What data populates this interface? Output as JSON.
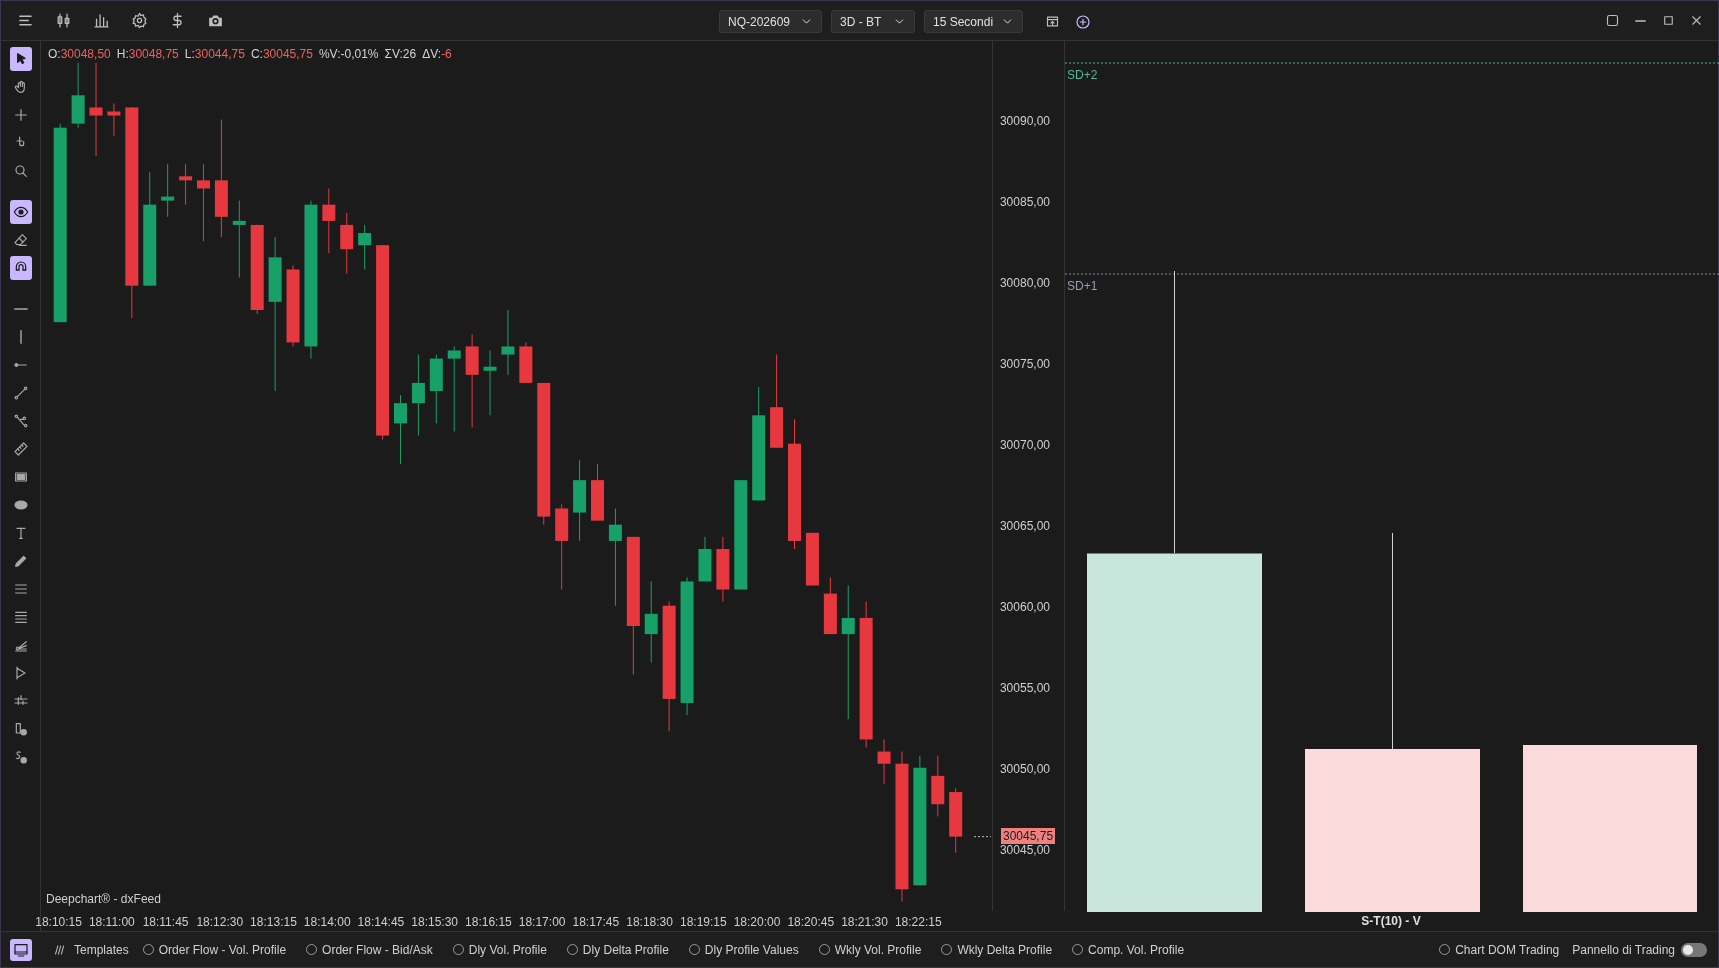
{
  "toolbar": {
    "instrument": "NQ-202609",
    "chart_type": "3D - BT",
    "interval": "15 Secondi"
  },
  "left_tools": [
    [
      {
        "selected": true
      },
      {
        "selected": false
      },
      {
        "selected": false
      },
      {
        "selected": false
      },
      {
        "selected": false
      }
    ],
    [
      {
        "selected": true
      },
      {
        "selected": false
      },
      {
        "selected": true
      }
    ],
    [
      {
        "selected": false
      },
      {
        "selected": false
      },
      {
        "selected": false
      },
      {
        "selected": false
      },
      {
        "selected": false
      },
      {
        "selected": false
      },
      {
        "selected": false
      },
      {
        "selected": false
      },
      {
        "selected": false
      },
      {
        "selected": false
      },
      {
        "selected": false
      },
      {
        "selected": false
      },
      {
        "selected": false
      },
      {
        "selected": false
      },
      {
        "selected": false
      },
      {
        "selected": false
      },
      {
        "selected": false
      }
    ]
  ],
  "ohlc": [
    {
      "label": "O:",
      "value": "30048,50",
      "color": "#f0605f"
    },
    {
      "label": "H:",
      "value": "30048,75",
      "color": "#f0605f"
    },
    {
      "label": "L:",
      "value": "30044,75",
      "color": "#f0605f"
    },
    {
      "label": "C:",
      "value": "30045,75",
      "color": "#f0605f"
    },
    {
      "label": "%V:",
      "value": "-0,01%",
      "color": "#d4d4d4"
    },
    {
      "label": "ΣV:",
      "value": "26",
      "color": "#d4d4d4"
    },
    {
      "label": "ΔV:",
      "value": "-6",
      "color": "#f0605f"
    }
  ],
  "chart_data": {
    "type": "candlestick",
    "ylim": [
      30041.1,
      30094.85
    ],
    "categories": [
      "18:10:15",
      null,
      null,
      "18:11:00",
      null,
      null,
      "18:11:45",
      null,
      null,
      "18:12:30",
      null,
      null,
      "18:13:15",
      null,
      null,
      "18:14:00",
      null,
      null,
      "18:14:45",
      null,
      null,
      "18:15:30",
      null,
      null,
      "18:16:15",
      null,
      null,
      "18:17:00",
      null,
      null,
      "18:17:45",
      null,
      null,
      "18:18:30",
      null,
      null,
      "18:19:15",
      null,
      null,
      "18:20:00",
      null,
      null,
      "18:20:45",
      null,
      null,
      "18:21:30",
      null,
      null,
      "18:22:15",
      null,
      null
    ],
    "ohlc": [
      [
        30077.5,
        30089.75,
        30077.5,
        30089.5
      ],
      [
        30089.75,
        30093.5,
        30089.5,
        30091.5
      ],
      [
        30090.75,
        30093.5,
        30087.75,
        30090.25
      ],
      [
        30090.5,
        30091,
        30089,
        30090.25
      ],
      [
        30090.75,
        30090.75,
        30077.75,
        30079.75
      ],
      [
        30079.75,
        30086.75,
        30079.75,
        30084.75
      ],
      [
        30085,
        30087.25,
        30084,
        30085.25
      ],
      [
        30086.5,
        30087.25,
        30084.75,
        30086.25
      ],
      [
        30086.25,
        30087.25,
        30082.5,
        30085.75
      ],
      [
        30086.25,
        30090,
        30082.75,
        30084
      ],
      [
        30083.5,
        30085,
        30080.25,
        30083.75
      ],
      [
        30083.5,
        30083.5,
        30078,
        30078.25
      ],
      [
        30078.75,
        30082.75,
        30073.25,
        30081.5
      ],
      [
        30080.75,
        30081,
        30076,
        30076.25
      ],
      [
        30076,
        30085,
        30075.25,
        30084.75
      ],
      [
        30084.75,
        30085.75,
        30081.75,
        30083.75
      ],
      [
        30083.5,
        30084.25,
        30080.5,
        30082
      ],
      [
        30082.25,
        30083.5,
        30080.75,
        30083
      ],
      [
        30082.25,
        30082.25,
        30070.25,
        30070.5
      ],
      [
        30071.25,
        30073,
        30068.75,
        30072.5
      ],
      [
        30072.5,
        30075.5,
        30070.5,
        30073.75
      ],
      [
        30073.25,
        30075.5,
        30071.25,
        30075.25
      ],
      [
        30075.25,
        30076,
        30070.75,
        30075.75
      ],
      [
        30076,
        30076.75,
        30071,
        30074.25
      ],
      [
        30074.5,
        30075.75,
        30071.75,
        30074.75
      ],
      [
        30075.5,
        30078.25,
        30074.25,
        30076
      ],
      [
        30076,
        30076.25,
        30073.75,
        30073.75
      ],
      [
        30073.75,
        30073.75,
        30065,
        30065.5
      ],
      [
        30066,
        30066.25,
        30061,
        30064
      ],
      [
        30065.75,
        30069,
        30064,
        30067.75
      ],
      [
        30067.75,
        30068.75,
        30065.25,
        30065.25
      ],
      [
        30064,
        30066,
        30060,
        30065
      ],
      [
        30064.25,
        30064.25,
        30055.75,
        30058.75
      ],
      [
        30058.25,
        30061.5,
        30056.5,
        30059.5
      ],
      [
        30060,
        30060.25,
        30052.25,
        30054.25
      ],
      [
        30054,
        30061.75,
        30053.25,
        30061.5
      ],
      [
        30061.5,
        30064.25,
        30061.5,
        30063.5
      ],
      [
        30063.5,
        30064.25,
        30060.25,
        30061
      ],
      [
        30061,
        30067.75,
        30061,
        30067.75
      ],
      [
        30066.5,
        30073.5,
        30066.5,
        30071.75
      ],
      [
        30072.25,
        30075.5,
        30069.75,
        30069.75
      ],
      [
        30070,
        30071.5,
        30063.5,
        30064
      ],
      [
        30064.5,
        30064.5,
        30061.25,
        30061.25
      ],
      [
        30060.75,
        30061.75,
        30058.25,
        30058.25
      ],
      [
        30058.25,
        30061.25,
        30053,
        30059.25
      ],
      [
        30059.25,
        30060.25,
        30051.25,
        30051.75
      ],
      [
        30051,
        30051.75,
        30049,
        30050.25
      ],
      [
        30050.25,
        30051,
        30041.75,
        30042.5
      ],
      [
        30042.75,
        30050.75,
        30042.75,
        30050
      ],
      [
        30049.5,
        30050.75,
        30047,
        30047.75
      ],
      [
        30048.5,
        30048.75,
        30044.75,
        30045.75
      ]
    ],
    "yticks": [
      {
        "value": 30090,
        "label": "30090,00"
      },
      {
        "value": 30085,
        "label": "30085,00"
      },
      {
        "value": 30080,
        "label": "30080,00"
      },
      {
        "value": 30075,
        "label": "30075,00"
      },
      {
        "value": 30070,
        "label": "30070,00"
      },
      {
        "value": 30065,
        "label": "30065,00"
      },
      {
        "value": 30060,
        "label": "30060,00"
      },
      {
        "value": 30055,
        "label": "30055,00"
      },
      {
        "value": 30050,
        "label": "30050,00"
      },
      {
        "value": 30045,
        "label": "30045,00"
      }
    ]
  },
  "last_price": "30045,75",
  "source_label": "Deepchart® - dxFeed",
  "study_panel": {
    "levels": [
      "SD+2",
      "SD+1"
    ],
    "title": "S-T(10) - V"
  },
  "bottom_bar": {
    "panel_toggle": {
      "selected": true
    },
    "templates_label": "Templates",
    "templates": [
      {
        "label": "Order Flow - Vol. Profile",
        "checked": false
      },
      {
        "label": "Order Flow - Bid/Ask",
        "checked": false
      },
      {
        "label": "Dly Vol. Profile",
        "checked": false
      },
      {
        "label": "Dly Delta Profile",
        "checked": false
      },
      {
        "label": "Dly Profile Values",
        "checked": false
      },
      {
        "label": "Wkly Vol. Profile",
        "checked": false
      },
      {
        "label": "Wkly Delta Profile",
        "checked": false
      },
      {
        "label": "Comp. Vol. Profile",
        "checked": false
      }
    ],
    "chart_dom": {
      "label": "Chart DOM Trading",
      "checked": false
    },
    "trading_panel": {
      "label": "Pannello di Trading",
      "on": false
    }
  }
}
